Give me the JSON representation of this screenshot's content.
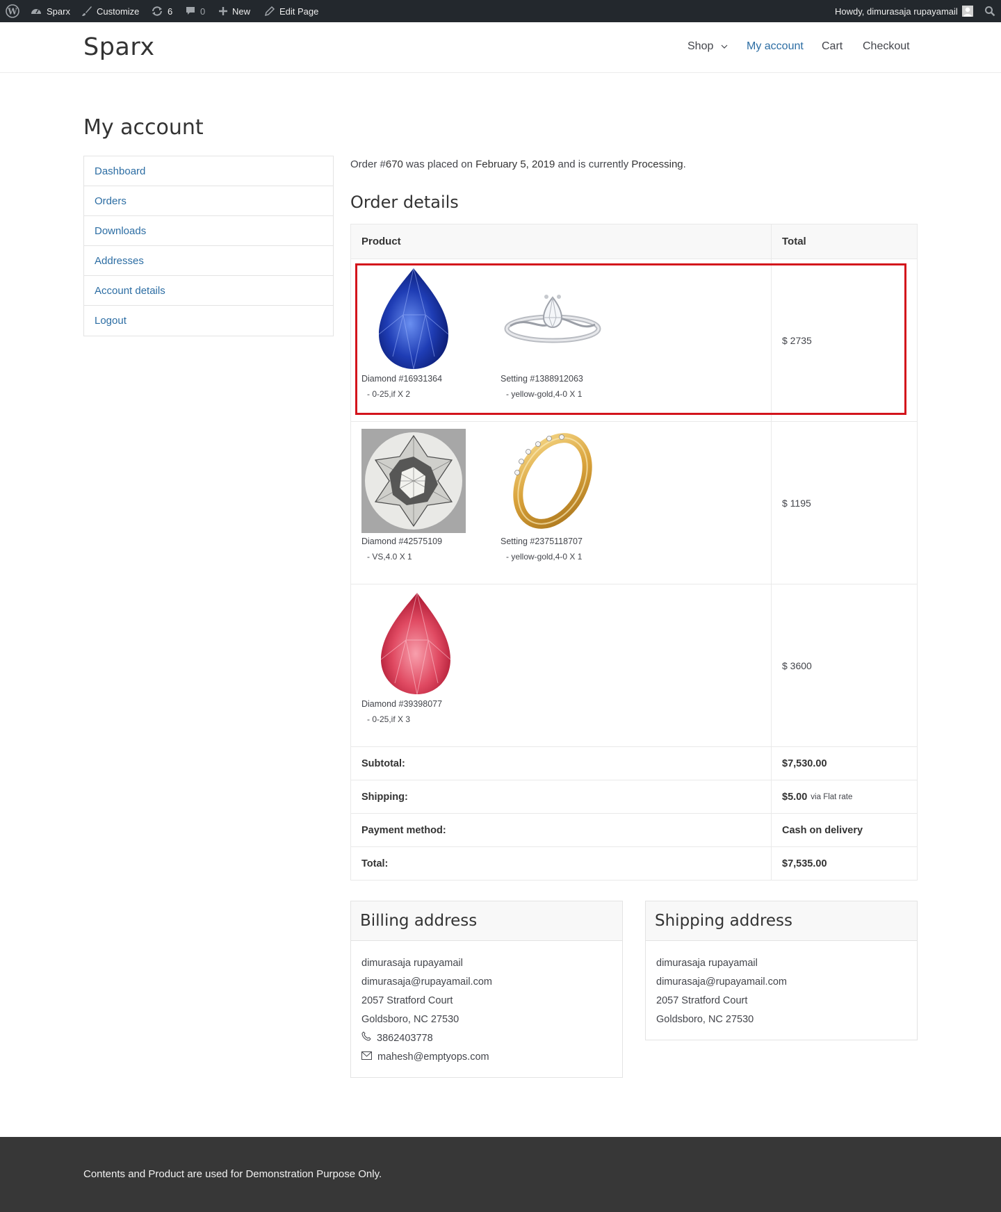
{
  "admin_bar": {
    "site_name": "Sparx",
    "customize": "Customize",
    "updates_count": "6",
    "comments_count": "0",
    "new_label": "New",
    "edit_page": "Edit Page",
    "howdy": "Howdy, dimurasaja rupayamail"
  },
  "header": {
    "site_title": "Sparx",
    "nav": {
      "shop": "Shop",
      "my_account": "My account",
      "cart": "Cart",
      "checkout": "Checkout"
    }
  },
  "page": {
    "title": "My account"
  },
  "account_nav": [
    "Dashboard",
    "Orders",
    "Downloads",
    "Addresses",
    "Account details",
    "Logout"
  ],
  "order": {
    "info_prefix": "Order #",
    "number": "670",
    "info_mid": " was placed on ",
    "date": "February 5, 2019",
    "info_mid2": " and is currently ",
    "status": "Processing",
    "info_end": "."
  },
  "order_details": {
    "title": "Order details",
    "col_product": "Product",
    "col_total": "Total",
    "items": [
      {
        "products": [
          {
            "name": "Diamond #16931364",
            "meta": "- 0-25,if X 2",
            "image": "blue-pear-diamond"
          },
          {
            "name": "Setting #1388912063",
            "meta": "- yellow-gold,4-0 X 1",
            "image": "silver-twist-ring"
          }
        ],
        "total": "$ 2735"
      },
      {
        "products": [
          {
            "name": "Diamond #42575109",
            "meta": "- VS,4.0 X 1",
            "image": "round-white-diamond"
          },
          {
            "name": "Setting #2375118707",
            "meta": "- yellow-gold,4-0 X 1",
            "image": "gold-band-ring"
          }
        ],
        "total": "$ 1195"
      },
      {
        "products": [
          {
            "name": "Diamond #39398077",
            "meta": "- 0-25,if X 3",
            "image": "red-pear-diamond"
          }
        ],
        "total": "$ 3600"
      }
    ],
    "totals": {
      "subtotal_label": "Subtotal:",
      "subtotal": "$7,530.00",
      "shipping_label": "Shipping:",
      "shipping": "$5.00",
      "shipping_via": "via Flat rate",
      "payment_label": "Payment method:",
      "payment": "Cash on delivery",
      "total_label": "Total:",
      "total": "$7,535.00"
    }
  },
  "billing": {
    "title": "Billing address",
    "name": "dimurasaja rupayamail",
    "email_line": "dimurasaja@rupayamail.com",
    "street": "2057 Stratford Court",
    "city": "Goldsboro, NC 27530",
    "phone": "3862403778",
    "email": "mahesh@emptyops.com"
  },
  "shipping": {
    "title": "Shipping address",
    "name": "dimurasaja rupayamail",
    "email_line": "dimurasaja@rupayamail.com",
    "street": "2057 Stratford Court",
    "city": "Goldsboro, NC 27530"
  },
  "footer": {
    "text": "Contents and Product are used for Demonstration Purpose Only."
  },
  "colors": {
    "link": "#2c6da3",
    "admin_bar": "#23282d",
    "footer": "#373737",
    "highlight": "#d3141c"
  }
}
